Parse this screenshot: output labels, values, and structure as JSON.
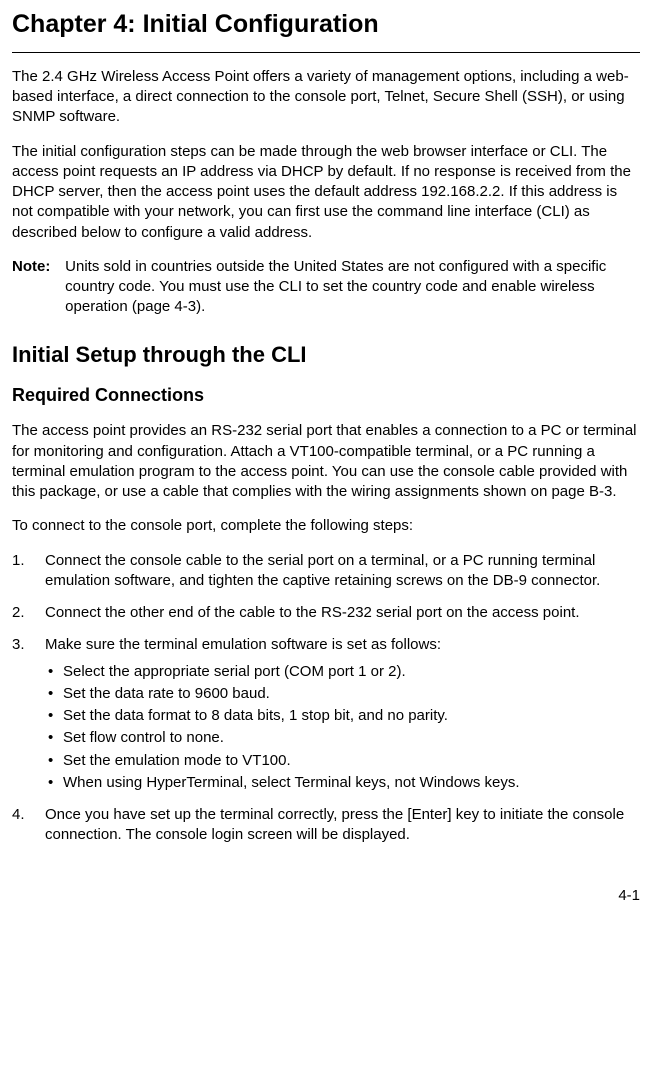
{
  "chapter_title": "Chapter 4: Initial Configuration",
  "intro_p1": "The  2.4 GHz Wireless Access Point offers a variety of management options, including a web-based interface, a direct connection to the console port, Telnet, Secure Shell (SSH), or using SNMP software.",
  "intro_p2": "The initial configuration steps can be made through the web browser interface or CLI. The access point requests an IP address via DHCP by default. If no response is received from the DHCP server, then the access point uses the default address 192.168.2.2. If this address is not compatible with your network, you can first use the command line interface (CLI) as described below to configure a valid address.",
  "note_label": "Note:",
  "note_body": "Units sold in countries outside the United States are not configured with a specific country code. You must use the CLI to set the country code and enable wireless operation (page 4-3).",
  "section_title": "Initial Setup through the CLI",
  "subsection_title": "Required Connections",
  "req_p1": "The access point provides an RS-232 serial port that enables a connection to a PC or terminal for monitoring and configuration. Attach a VT100-compatible terminal, or a PC running a terminal emulation program to the access point. You can use the console cable provided with this package, or use a cable that complies with the wiring assignments shown on page B-3.",
  "req_p2": "To connect to the console port, complete the following steps:",
  "steps": {
    "s1_num": "1.",
    "s1": "Connect the console cable to the serial port on a terminal, or a PC running terminal emulation software, and tighten the captive retaining screws on the DB-9 connector.",
    "s2_num": "2.",
    "s2": "Connect the other end of the cable to the RS-232 serial port on the access point.",
    "s3_num": "3.",
    "s3": "Make sure the terminal emulation software is set as follows:",
    "s3_bullets": {
      "b1": "Select the appropriate serial port (COM port 1 or 2).",
      "b2": "Set the data rate to 9600 baud.",
      "b3": "Set the data format to 8 data bits, 1 stop bit, and no parity.",
      "b4": "Set flow control to none.",
      "b5": "Set the emulation mode to VT100.",
      "b6": "When using HyperTerminal, select Terminal keys, not Windows keys."
    },
    "s4_num": "4.",
    "s4": "Once you have set up the terminal correctly, press the [Enter] key to initiate the console connection. The console login screen will be displayed."
  },
  "page_number": "4-1"
}
